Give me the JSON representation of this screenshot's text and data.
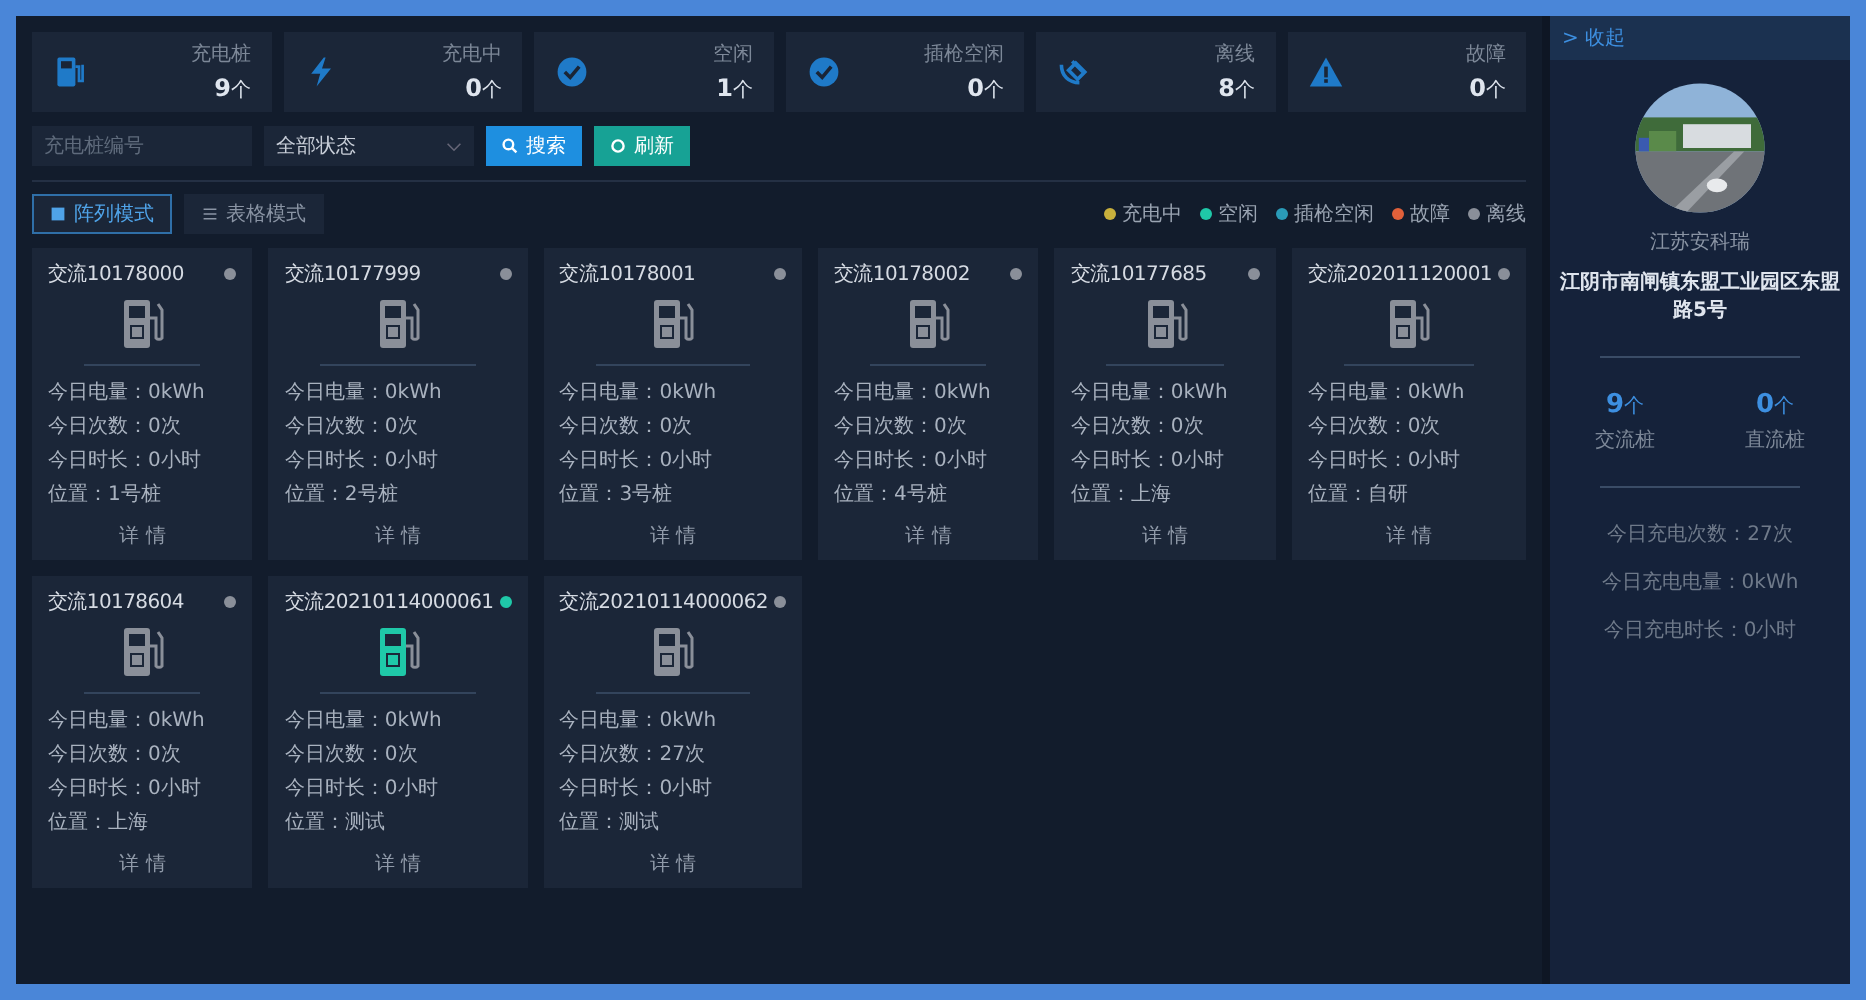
{
  "stats": [
    {
      "kind": "charger",
      "label": "充电桩",
      "count": "9",
      "unit": "个"
    },
    {
      "kind": "charging",
      "label": "充电中",
      "count": "0",
      "unit": "个"
    },
    {
      "kind": "idle",
      "label": "空闲",
      "count": "1",
      "unit": "个"
    },
    {
      "kind": "plug-idle",
      "label": "插枪空闲",
      "count": "0",
      "unit": "个"
    },
    {
      "kind": "offline",
      "label": "离线",
      "count": "8",
      "unit": "个"
    },
    {
      "kind": "fault",
      "label": "故障",
      "count": "0",
      "unit": "个"
    }
  ],
  "toolbar": {
    "search": {
      "placeholder": "充电桩编号"
    },
    "status_select": "全部状态",
    "buttons": [
      {
        "kind": "search",
        "label": "搜索"
      },
      {
        "kind": "refresh",
        "label": "刷新"
      }
    ]
  },
  "view_modes": [
    {
      "kind": "grid",
      "label": "阵列模式",
      "selected": true
    },
    {
      "kind": "list",
      "label": "表格模式",
      "selected": false
    }
  ],
  "legend": [
    {
      "label": "充电中",
      "color": "#c8b03c"
    },
    {
      "label": "空闲",
      "color": "#1fc8a8"
    },
    {
      "label": "插枪空闲",
      "color": "#2a9bb8"
    },
    {
      "label": "故障",
      "color": "#e0603a"
    },
    {
      "label": "离线",
      "color": "#8a8f99"
    }
  ],
  "cards": [
    {
      "name": "交流10178000",
      "color": "#8a8f99",
      "lines": [
        "今日电量：0kWh",
        "今日次数：0次",
        "今日时长：0小时",
        "位置：1号桩"
      ],
      "link": "详 情"
    },
    {
      "name": "交流10177999",
      "color": "#8a8f99",
      "lines": [
        "今日电量：0kWh",
        "今日次数：0次",
        "今日时长：0小时",
        "位置：2号桩"
      ],
      "link": "详 情"
    },
    {
      "name": "交流10178001",
      "color": "#8a8f99",
      "lines": [
        "今日电量：0kWh",
        "今日次数：0次",
        "今日时长：0小时",
        "位置：3号桩"
      ],
      "link": "详 情"
    },
    {
      "name": "交流10178002",
      "color": "#8a8f99",
      "lines": [
        "今日电量：0kWh",
        "今日次数：0次",
        "今日时长：0小时",
        "位置：4号桩"
      ],
      "link": "详 情"
    },
    {
      "name": "交流10177685",
      "color": "#8a8f99",
      "lines": [
        "今日电量：0kWh",
        "今日次数：0次",
        "今日时长：0小时",
        "位置：上海"
      ],
      "link": "详 情"
    },
    {
      "name": "交流202011120001",
      "color": "#8a8f99",
      "lines": [
        "今日电量：0kWh",
        "今日次数：0次",
        "今日时长：0小时",
        "位置：自研"
      ],
      "link": "详 情"
    },
    {
      "name": "交流10178604",
      "color": "#8a8f99",
      "lines": [
        "今日电量：0kWh",
        "今日次数：0次",
        "今日时长：0小时",
        "位置：上海"
      ],
      "link": "详 情"
    },
    {
      "name": "交流20210114000061",
      "color": "#1fc8a8",
      "lines": [
        "今日电量：0kWh",
        "今日次数：0次",
        "今日时长：0小时",
        "位置：测试"
      ],
      "link": "详 情"
    },
    {
      "name": "交流20210114000062",
      "color": "#8a8f99",
      "lines": [
        "今日电量：0kWh",
        "今日次数：27次",
        "今日时长：0小时",
        "位置：测试"
      ],
      "link": "详 情"
    }
  ],
  "side_panel": {
    "collapse": "> 收起",
    "photo": {
      "kind": "picture"
    },
    "station": "江苏安科瑞",
    "address": "江阴市南闸镇东盟工业园区东盟路5号",
    "counts": [
      {
        "value": "9",
        "unit": "个",
        "label": "交流桩"
      },
      {
        "value": "0",
        "unit": "个",
        "label": "直流桩"
      }
    ],
    "today": [
      "今日充电次数：27次",
      "今日充电电量：0kWh",
      "今日充电时长：0小时"
    ]
  }
}
